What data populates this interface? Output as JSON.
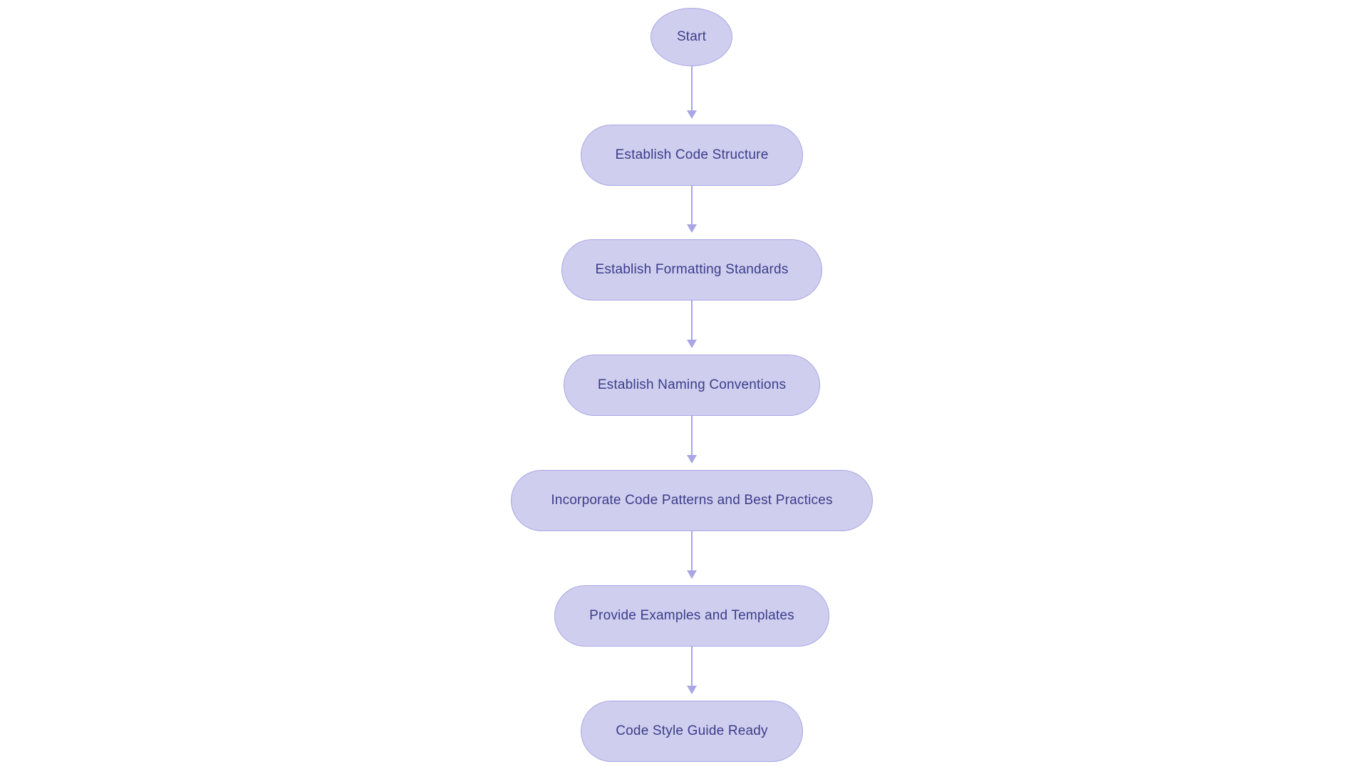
{
  "flowchart": {
    "nodes": [
      {
        "id": "start",
        "label": "Start",
        "shape": "ellipse"
      },
      {
        "id": "structure",
        "label": "Establish Code Structure",
        "shape": "pill"
      },
      {
        "id": "formatting",
        "label": "Establish Formatting Standards",
        "shape": "pill"
      },
      {
        "id": "naming",
        "label": "Establish Naming Conventions",
        "shape": "pill"
      },
      {
        "id": "patterns",
        "label": "Incorporate Code Patterns and Best Practices",
        "shape": "pill"
      },
      {
        "id": "examples",
        "label": "Provide Examples and Templates",
        "shape": "pill"
      },
      {
        "id": "ready",
        "label": "Code Style Guide Ready",
        "shape": "pill"
      }
    ],
    "colors": {
      "node_fill": "#cfceef",
      "node_border": "#a9a6e3",
      "node_text": "#3b3d8a",
      "arrow": "#a9a6e3"
    }
  }
}
